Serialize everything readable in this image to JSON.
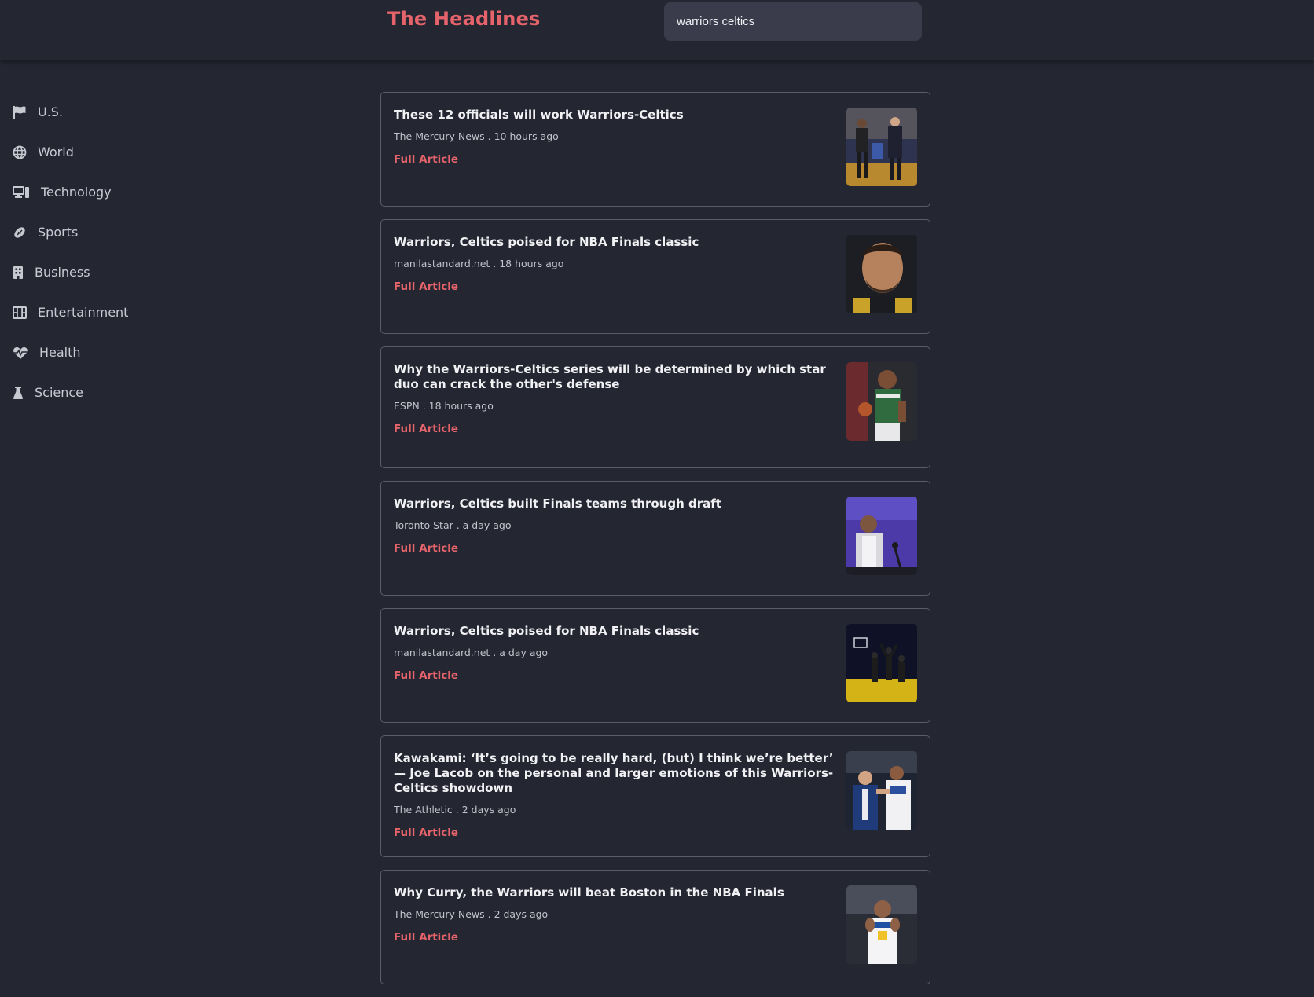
{
  "header": {
    "title": "The Headlines",
    "search": {
      "value": "warriors celtics",
      "placeholder": ""
    }
  },
  "sidebar": {
    "items": [
      {
        "label": "U.S.",
        "icon": "flag-icon"
      },
      {
        "label": "World",
        "icon": "globe-icon"
      },
      {
        "label": "Technology",
        "icon": "computer-icon"
      },
      {
        "label": "Sports",
        "icon": "football-icon"
      },
      {
        "label": "Business",
        "icon": "building-icon"
      },
      {
        "label": "Entertainment",
        "icon": "film-icon"
      },
      {
        "label": "Health",
        "icon": "heartbeat-icon"
      },
      {
        "label": "Science",
        "icon": "flask-icon"
      }
    ]
  },
  "articles": [
    {
      "title": "These 12 officials will work Warriors-Celtics",
      "meta": "The Mercury News . 10 hours ago",
      "link": "Full Article"
    },
    {
      "title": "Warriors, Celtics poised for NBA Finals classic",
      "meta": "manilastandard.net . 18 hours ago",
      "link": "Full Article"
    },
    {
      "title": "Why the Warriors-Celtics series will be determined by which star duo can crack the other's defense",
      "meta": "ESPN . 18 hours ago",
      "link": "Full Article"
    },
    {
      "title": "Warriors, Celtics built Finals teams through draft",
      "meta": "Toronto Star . a day ago",
      "link": "Full Article"
    },
    {
      "title": "Warriors, Celtics poised for NBA Finals classic",
      "meta": "manilastandard.net . a day ago",
      "link": "Full Article"
    },
    {
      "title": "Kawakami: ‘It’s going to be really hard, (but) I think we’re better’ — Joe Lacob on the personal and larger emotions of this Warriors-Celtics showdown",
      "meta": "The Athletic . 2 days ago",
      "link": "Full Article"
    },
    {
      "title": "Why Curry, the Warriors will beat Boston in the NBA Finals",
      "meta": "The Mercury News . 2 days ago",
      "link": "Full Article"
    }
  ],
  "colors": {
    "background": "#242632",
    "accent": "#e5636a",
    "card_border": "#5a5c6b",
    "search_bg": "#3a3c4c"
  }
}
